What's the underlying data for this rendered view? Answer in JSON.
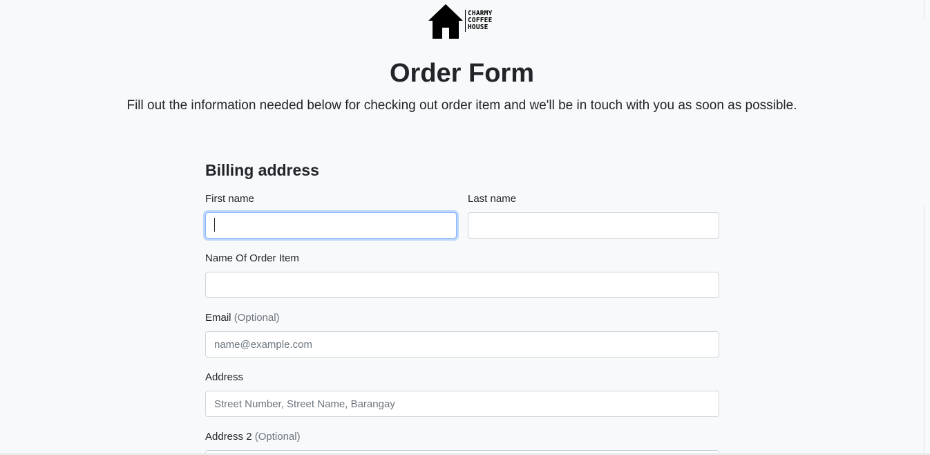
{
  "brand": {
    "logo_lines": [
      "CHARMY",
      "COFFEE",
      "HOUSE"
    ]
  },
  "header": {
    "title": "Order Form",
    "lead": "Fill out the information needed below for checking out order item and we'll be in touch with you as soon as possible."
  },
  "billing": {
    "section_title": "Billing address",
    "first_name": {
      "label": "First name",
      "value": "",
      "placeholder": ""
    },
    "last_name": {
      "label": "Last name",
      "value": "",
      "placeholder": ""
    },
    "order_item": {
      "label": "Name Of Order Item",
      "value": "",
      "placeholder": ""
    },
    "email": {
      "label": "Email",
      "optional": "(Optional)",
      "placeholder": "name@example.com"
    },
    "address": {
      "label": "Address",
      "placeholder": "Street Number, Street Name, Barangay"
    },
    "address2": {
      "label": "Address 2",
      "optional": "(Optional)"
    }
  },
  "colors": {
    "background": "#f8f9fa",
    "focus_border": "#86b7fe",
    "muted_text": "#6c757d"
  }
}
